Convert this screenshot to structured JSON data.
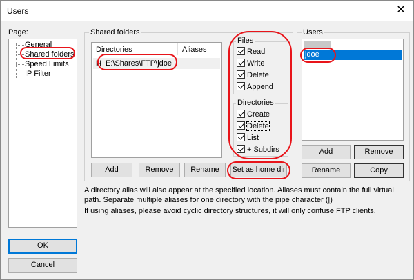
{
  "window": {
    "title": "Users",
    "close_glyph": "✕"
  },
  "page_panel": {
    "label": "Page:",
    "items": [
      {
        "label": "General"
      },
      {
        "label": "Shared folders"
      },
      {
        "label": "Speed Limits"
      },
      {
        "label": "IP Filter"
      }
    ]
  },
  "shared_folders": {
    "group_label": "Shared folders",
    "columns": [
      "Directories",
      "Aliases"
    ],
    "rows": [
      {
        "home_marker": "H",
        "directory": "E:\\Shares\\FTP\\jdoe",
        "alias": ""
      }
    ],
    "buttons": {
      "add": "Add",
      "remove": "Remove",
      "rename": "Rename",
      "set_home": "Set as home dir"
    }
  },
  "permissions": {
    "files_label": "Files",
    "files": [
      {
        "label": "Read",
        "checked": true
      },
      {
        "label": "Write",
        "checked": true
      },
      {
        "label": "Delete",
        "checked": true
      },
      {
        "label": "Append",
        "checked": true
      }
    ],
    "dirs_label": "Directories",
    "dirs": [
      {
        "label": "Create",
        "checked": true
      },
      {
        "label": "Delete",
        "checked": true
      },
      {
        "label": "List",
        "checked": true
      },
      {
        "label": "+ Subdirs",
        "checked": true
      }
    ]
  },
  "users": {
    "group_label": "Users",
    "header_blurred": "",
    "selected_user": "jdoe",
    "buttons": {
      "add": "Add",
      "remove": "Remove",
      "rename": "Rename",
      "copy": "Copy"
    }
  },
  "info": {
    "line1": "A directory alias will also appear at the specified location. Aliases must contain the full virtual",
    "line2": "path. Separate multiple aliases for one directory with the pipe character (|)",
    "line3": "If using aliases, please avoid cyclic directory structures, it will only confuse FTP clients."
  },
  "dialog_buttons": {
    "ok": "OK",
    "cancel": "Cancel"
  },
  "colors": {
    "annotation": "#e8141a",
    "selection": "#0078d7",
    "focus": "#0078d7"
  }
}
